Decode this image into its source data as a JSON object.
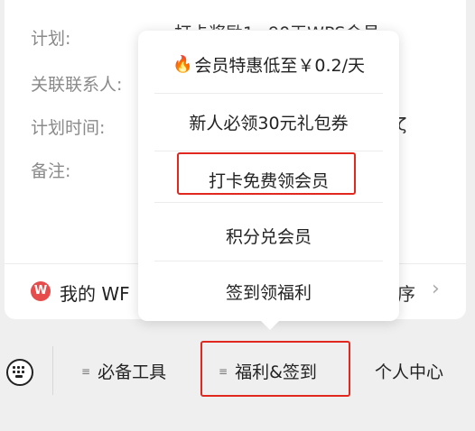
{
  "background_card": {
    "fields": [
      {
        "label": "计划:",
        "value": "打卡奖励1~90天WPS会员"
      },
      {
        "label": "关联联系人:",
        "value": ""
      },
      {
        "label": "计划时间:",
        "value": "ζ"
      },
      {
        "label": "备注:",
        "value": ""
      }
    ],
    "wps_row": {
      "icon_text": "W",
      "label": "我的 WF",
      "tail": "序"
    }
  },
  "popup": {
    "items": [
      {
        "label": "会员特惠低至￥0.2/天",
        "icon": "fire-icon"
      },
      {
        "label": "新人必领30元礼包券"
      },
      {
        "label": "打卡免费领会员",
        "highlighted": true
      },
      {
        "label": "积分兑会员"
      },
      {
        "label": "签到领福利"
      }
    ]
  },
  "toolbar": {
    "keyboard_icon": "keyboard-icon",
    "items": [
      {
        "label": "必备工具",
        "icon": "menu-icon"
      },
      {
        "label": "福利&签到",
        "icon": "menu-icon",
        "highlighted": true
      },
      {
        "label": "个人中心"
      }
    ]
  },
  "colors": {
    "highlight": "#e0281e",
    "wps_red": "#e64c4c"
  }
}
